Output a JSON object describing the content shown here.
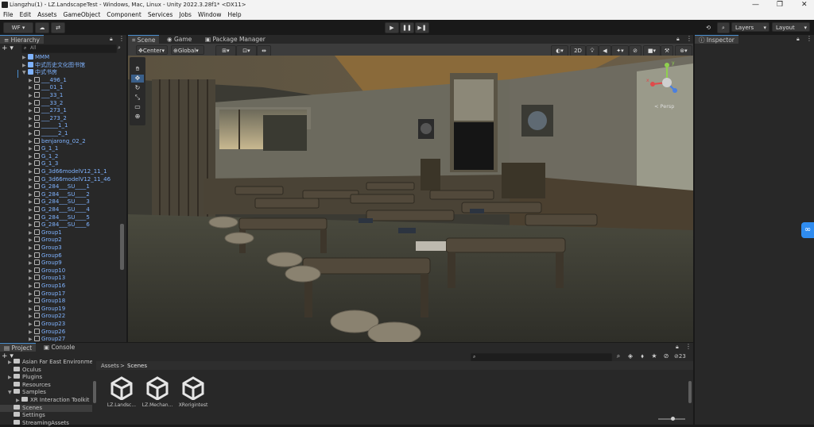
{
  "window": {
    "title": "Liangzhu(1) - LZ.LandscapeTest - Windows, Mac, Linux - Unity 2022.3.28f1* <DX11>",
    "minimize": "—",
    "maximize": "❐",
    "close": "✕"
  },
  "menu": [
    "File",
    "Edit",
    "Assets",
    "GameObject",
    "Component",
    "Services",
    "Jobs",
    "Window",
    "Help"
  ],
  "toolbar": {
    "account": "WF ▾",
    "cloud_icon": "cloud-icon",
    "collab_icon": "collab-icon",
    "play": "▶",
    "pause": "❚❚",
    "step": "▶❚",
    "history": "⟲",
    "search": "⌕",
    "layers": "Layers",
    "layout": "Layout"
  },
  "hierarchy": {
    "tab": "Hierarchy",
    "search_placeholder": "All",
    "items": [
      {
        "label": "MMM",
        "depth": 1,
        "prefab": true,
        "arrow": "▶"
      },
      {
        "label": "中式历史文化图书馆",
        "depth": 1,
        "prefab": true,
        "arrow": "▶"
      },
      {
        "label": "中式书房",
        "depth": 1,
        "prefab": true,
        "arrow": "▼"
      },
      {
        "label": "___496_1",
        "depth": 2,
        "prefab": false,
        "arrow": "▶"
      },
      {
        "label": "___01_1",
        "depth": 2,
        "prefab": false,
        "arrow": "▶"
      },
      {
        "label": "___33_1",
        "depth": 2,
        "prefab": false,
        "arrow": "▶"
      },
      {
        "label": "___33_2",
        "depth": 2,
        "prefab": false,
        "arrow": "▶"
      },
      {
        "label": "___273_1",
        "depth": 2,
        "prefab": false,
        "arrow": "▶"
      },
      {
        "label": "___273_2",
        "depth": 2,
        "prefab": false,
        "arrow": "▶"
      },
      {
        "label": "______1_1",
        "depth": 2,
        "prefab": false,
        "arrow": "▶"
      },
      {
        "label": "______2_1",
        "depth": 2,
        "prefab": false,
        "arrow": "▶"
      },
      {
        "label": "benjarong_02_2",
        "depth": 2,
        "prefab": false,
        "arrow": "▶"
      },
      {
        "label": "G_1_1",
        "depth": 2,
        "prefab": false,
        "arrow": "▶"
      },
      {
        "label": "G_1_2",
        "depth": 2,
        "prefab": false,
        "arrow": "▶"
      },
      {
        "label": "G_1_3",
        "depth": 2,
        "prefab": false,
        "arrow": "▶"
      },
      {
        "label": "G_3d66modelV12_11_1",
        "depth": 2,
        "prefab": false,
        "arrow": "▶"
      },
      {
        "label": "G_3d66modelV12_11_46",
        "depth": 2,
        "prefab": false,
        "arrow": "▶"
      },
      {
        "label": "G_284___SU____1",
        "depth": 2,
        "prefab": false,
        "arrow": "▶"
      },
      {
        "label": "G_284___SU____2",
        "depth": 2,
        "prefab": false,
        "arrow": "▶"
      },
      {
        "label": "G_284___SU____3",
        "depth": 2,
        "prefab": false,
        "arrow": "▶"
      },
      {
        "label": "G_284___SU____4",
        "depth": 2,
        "prefab": false,
        "arrow": "▶"
      },
      {
        "label": "G_284___SU____5",
        "depth": 2,
        "prefab": false,
        "arrow": "▶"
      },
      {
        "label": "G_284___SU____6",
        "depth": 2,
        "prefab": false,
        "arrow": "▶"
      },
      {
        "label": "Group1",
        "depth": 2,
        "prefab": false,
        "arrow": "▶"
      },
      {
        "label": "Group2",
        "depth": 2,
        "prefab": false,
        "arrow": "▶"
      },
      {
        "label": "Group3",
        "depth": 2,
        "prefab": false,
        "arrow": "▶"
      },
      {
        "label": "Group6",
        "depth": 2,
        "prefab": false,
        "arrow": "▶"
      },
      {
        "label": "Group9",
        "depth": 2,
        "prefab": false,
        "arrow": "▶"
      },
      {
        "label": "Group10",
        "depth": 2,
        "prefab": false,
        "arrow": "▶"
      },
      {
        "label": "Group13",
        "depth": 2,
        "prefab": false,
        "arrow": "▶"
      },
      {
        "label": "Group16",
        "depth": 2,
        "prefab": false,
        "arrow": "▶"
      },
      {
        "label": "Group17",
        "depth": 2,
        "prefab": false,
        "arrow": "▶"
      },
      {
        "label": "Group18",
        "depth": 2,
        "prefab": false,
        "arrow": "▶"
      },
      {
        "label": "Group19",
        "depth": 2,
        "prefab": false,
        "arrow": "▶"
      },
      {
        "label": "Group22",
        "depth": 2,
        "prefab": false,
        "arrow": "▶"
      },
      {
        "label": "Group23",
        "depth": 2,
        "prefab": false,
        "arrow": "▶"
      },
      {
        "label": "Group26",
        "depth": 2,
        "prefab": false,
        "arrow": "▶"
      },
      {
        "label": "Group27",
        "depth": 2,
        "prefab": false,
        "arrow": "▶"
      }
    ]
  },
  "scene": {
    "tabs": [
      "Scene",
      "Game",
      "Package Manager"
    ],
    "pivot": "Center",
    "space": "Global",
    "mode_2d": "2D",
    "persp": "< Persp",
    "gizmo_labels": {
      "x": "x",
      "y": "y"
    }
  },
  "inspector": {
    "tab": "Inspector"
  },
  "project": {
    "tabs": [
      "Project",
      "Console"
    ],
    "breadcrumb": [
      "Assets",
      "Scenes"
    ],
    "badge": "23",
    "folders": [
      {
        "label": "Asian Far East Environme",
        "indent": 1,
        "arrow": "▶"
      },
      {
        "label": "Oculus",
        "indent": 1,
        "arrow": ""
      },
      {
        "label": "Plugins",
        "indent": 1,
        "arrow": "▶"
      },
      {
        "label": "Resources",
        "indent": 1,
        "arrow": ""
      },
      {
        "label": "Samples",
        "indent": 1,
        "arrow": "▼"
      },
      {
        "label": "XR Interaction Toolkit",
        "indent": 2,
        "arrow": "▶"
      },
      {
        "label": "Scenes",
        "indent": 1,
        "arrow": ""
      },
      {
        "label": "Settings",
        "indent": 1,
        "arrow": ""
      },
      {
        "label": "StreamingAssets",
        "indent": 1,
        "arrow": ""
      }
    ],
    "assets": [
      "LZ.Landsc...",
      "LZ.Mechan...",
      "XRorigintest"
    ]
  },
  "colors": {
    "accent": "#4a8fd0",
    "prefab": "#7fb3ff",
    "panel": "#282828",
    "side_widget": "#2f8cf0"
  }
}
